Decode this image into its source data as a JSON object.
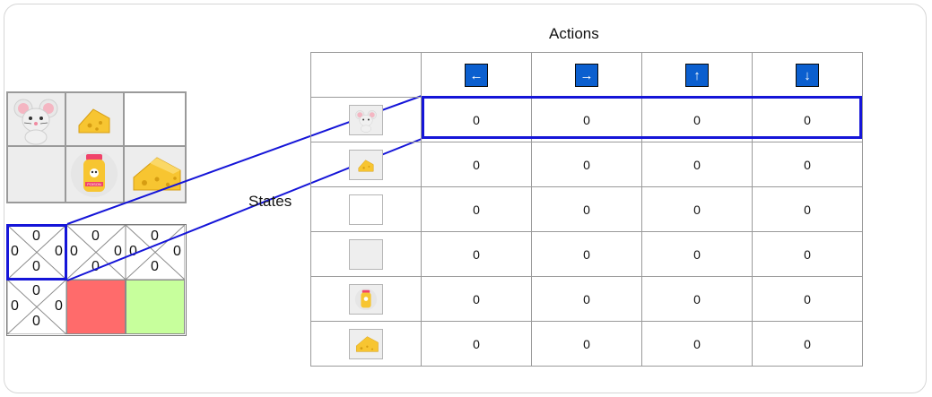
{
  "titles": {
    "actions": "Actions",
    "states": "States"
  },
  "actions": [
    {
      "icon": "left-arrow-icon",
      "glyph": "←"
    },
    {
      "icon": "right-arrow-icon",
      "glyph": "→"
    },
    {
      "icon": "up-arrow-icon",
      "glyph": "↑"
    },
    {
      "icon": "down-arrow-icon",
      "glyph": "↓"
    }
  ],
  "states": [
    {
      "icon": "mouse-icon"
    },
    {
      "icon": "small-cheese-icon"
    },
    {
      "icon": "empty-white-cell-icon"
    },
    {
      "icon": "empty-grey-cell-icon"
    },
    {
      "icon": "poison-bottle-icon"
    },
    {
      "icon": "big-cheese-icon"
    }
  ],
  "q_values": [
    [
      "0",
      "0",
      "0",
      "0"
    ],
    [
      "0",
      "0",
      "0",
      "0"
    ],
    [
      "0",
      "0",
      "0",
      "0"
    ],
    [
      "0",
      "0",
      "0",
      "0"
    ],
    [
      "0",
      "0",
      "0",
      "0"
    ],
    [
      "0",
      "0",
      "0",
      "0"
    ]
  ],
  "poison_label": "POISON",
  "mini_grid": {
    "cells": [
      {
        "top": "0",
        "left": "0",
        "right": "0",
        "bottom": "0"
      },
      {
        "top": "0",
        "left": "0",
        "right": "0",
        "bottom": "0"
      },
      {
        "top": "0",
        "left": "0",
        "right": "0",
        "bottom": "0"
      },
      {
        "top": "0",
        "left": "0",
        "right": "0",
        "bottom": "0"
      }
    ],
    "terminal_colors": {
      "poison": "#ff6b6b",
      "cheese": "#c7ff9c"
    }
  },
  "colors": {
    "highlight": "#1515d8",
    "arrow_bg": "#0b5fcf"
  }
}
